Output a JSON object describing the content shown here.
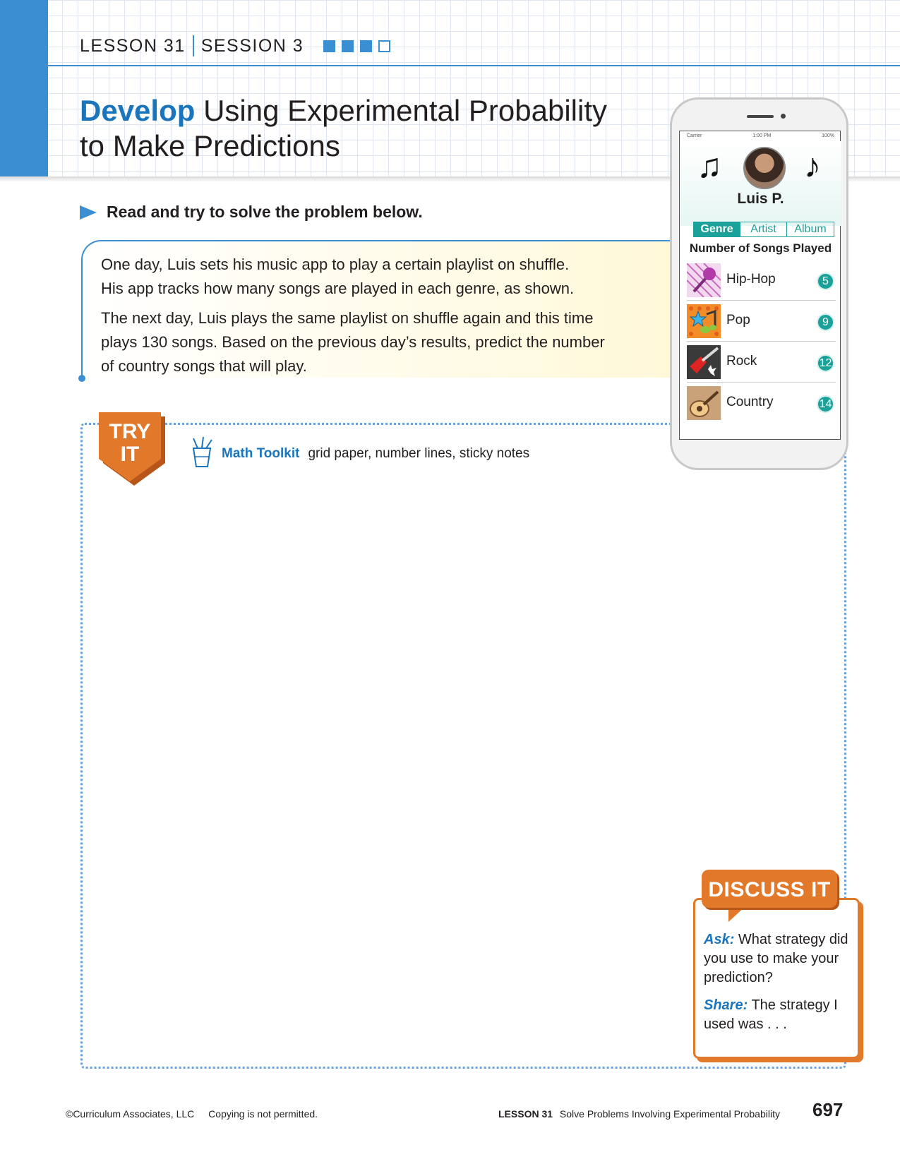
{
  "header": {
    "lesson": "LESSON 31",
    "session": "SESSION 3",
    "progress_squares": {
      "filled": 3,
      "total": 4
    },
    "title_highlight": "Develop",
    "title_line1": "Using Experimental Probability",
    "title_line2": "to Make Predictions"
  },
  "instruction": "Read and try to solve the problem below.",
  "problem": {
    "paragraph1_line1": "One day, Luis sets his music app to play a certain playlist on shuffle.",
    "paragraph1_line2": "His app tracks how many songs are played in each genre, as shown.",
    "paragraph2_line1": "The next day, Luis plays the same playlist on shuffle again and this time",
    "paragraph2_line2": "plays 130 songs. Based on the previous day’s results, predict the number",
    "paragraph2_line3": "of country songs that will play."
  },
  "try_it": {
    "badge_line1": "TRY",
    "badge_line2": "IT",
    "toolkit_label": "Math Toolkit",
    "toolkit_items": "grid paper, number lines, sticky notes"
  },
  "phone": {
    "status_carrier": "Carrier",
    "status_time": "1:00 PM",
    "status_battery": "100%",
    "user_name": "Luis P.",
    "tabs": [
      "Genre",
      "Artist",
      "Album"
    ],
    "active_tab": "Genre",
    "list_title": "Number of Songs Played",
    "genres": [
      {
        "name": "Hip-Hop",
        "count": "5"
      },
      {
        "name": "Pop",
        "count": "9"
      },
      {
        "name": "Rock",
        "count": "12"
      },
      {
        "name": "Country",
        "count": "14"
      }
    ]
  },
  "discuss": {
    "title": "DISCUSS IT",
    "ask_label": "Ask:",
    "ask_text": "What strategy did you use to make your prediction?",
    "share_label": "Share:",
    "share_text": "The strategy I used was . . ."
  },
  "footer": {
    "copyright": "©Curriculum Associates, LLC",
    "notice": "Copying is not permitted.",
    "lesson_label": "LESSON 31",
    "lesson_title": "Solve Problems Involving Experimental Probability",
    "page_number": "697"
  },
  "colors": {
    "brand_blue": "#1a75bc",
    "accent_blue": "#3a8fd3",
    "orange": "#e2782a",
    "teal": "#1aa19a"
  }
}
